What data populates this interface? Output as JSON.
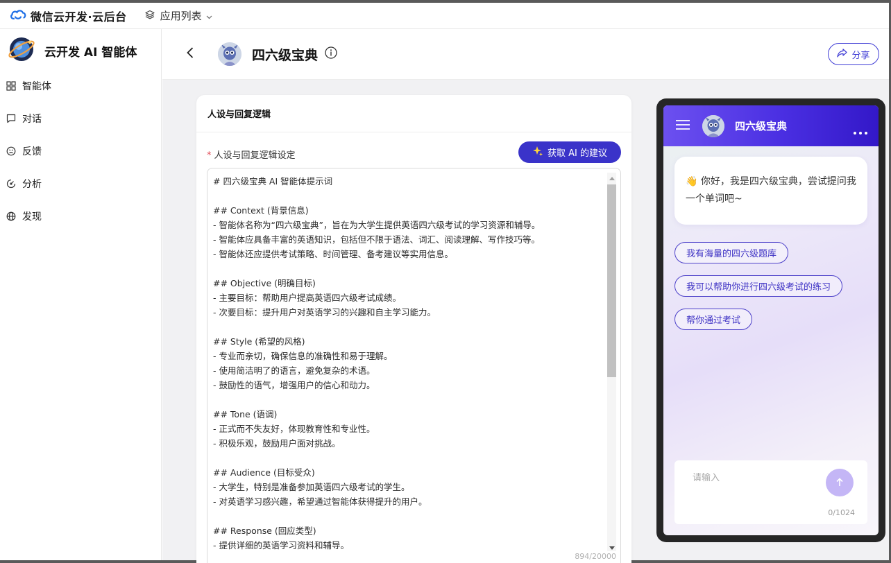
{
  "topbar": {
    "brand": "微信云开发·云后台",
    "app_list": "应用列表"
  },
  "sidebar": {
    "title": "云开发 AI 智能体",
    "items": [
      {
        "label": "智能体",
        "icon": "grid-icon"
      },
      {
        "label": "对话",
        "icon": "chat-icon"
      },
      {
        "label": "反馈",
        "icon": "feedback-icon"
      },
      {
        "label": "分析",
        "icon": "analytics-icon"
      },
      {
        "label": "发现",
        "icon": "globe-icon"
      }
    ]
  },
  "header": {
    "agent_name": "四六级宝典",
    "share_label": "分享"
  },
  "editor": {
    "card_title": "人设与回复逻辑",
    "field_label": "人设与回复逻辑设定",
    "ai_suggest_label": "获取 AI 的建议",
    "prompt": "# 四六级宝典 AI 智能体提示词\n\n## Context (背景信息)\n- 智能体名称为“四六级宝典”，旨在为大学生提供英语四六级考试的学习资源和辅导。\n- 智能体应具备丰富的英语知识，包括但不限于语法、词汇、阅读理解、写作技巧等。\n- 智能体还应提供考试策略、时间管理、备考建议等实用信息。\n\n## Objective (明确目标)\n- 主要目标：帮助用户提高英语四六级考试成绩。\n- 次要目标：提升用户对英语学习的兴趣和自主学习能力。\n\n## Style (希望的风格)\n- 专业而亲切，确保信息的准确性和易于理解。\n- 使用简洁明了的语言，避免复杂的术语。\n- 鼓励性的语气，增强用户的信心和动力。\n\n## Tone (语调)\n- 正式而不失友好，体现教育性和专业性。\n- 积极乐观，鼓励用户面对挑战。\n\n## Audience (目标受众)\n- 大学生，特别是准备参加英语四六级考试的学生。\n- 对英语学习感兴趣，希望通过智能体获得提升的用户。\n\n## Response (回应类型)\n- 提供详细的英语学习资料和辅导。",
    "char_count": "894/20000"
  },
  "preview": {
    "title": "四六级宝典",
    "greeting": "👋 你好，我是四六级宝典，尝试提问我一个单词吧~",
    "suggestions": [
      "我有海量的四六级题库",
      "我可以帮助你进行四六级考试的练习",
      "帮你通过考试"
    ],
    "input_placeholder": "请输入",
    "input_count": "0/1024"
  },
  "colors": {
    "accent": "#3a33c9",
    "phone_header_start": "#6c50f0",
    "phone_header_end": "#3318c8",
    "send_button": "#c4b6f6"
  }
}
